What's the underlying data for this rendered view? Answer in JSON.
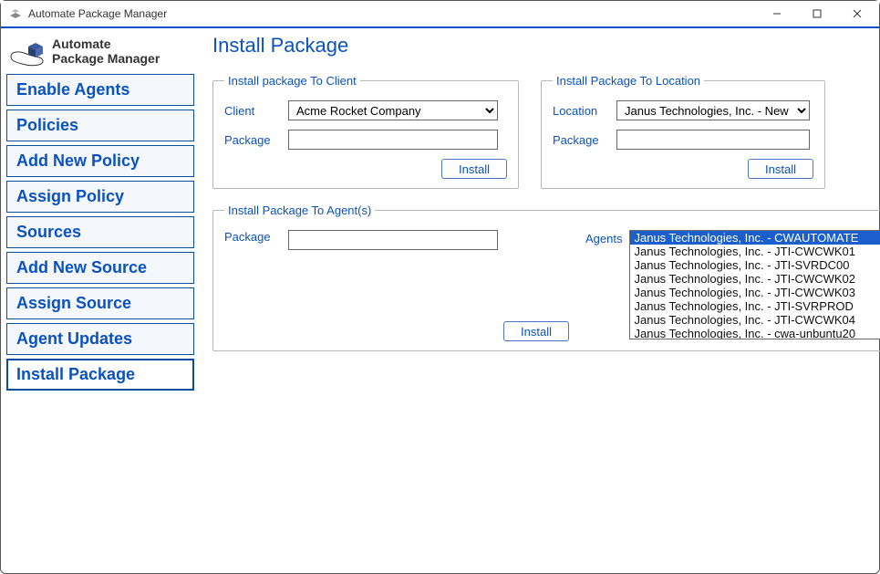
{
  "window": {
    "title": "Automate Package Manager"
  },
  "brand": {
    "line1": "Automate",
    "line2": "Package Manager"
  },
  "nav": {
    "items": [
      "Enable Agents",
      "Policies",
      "Add New Policy",
      "Assign Policy",
      "Sources",
      "Add New Source",
      "Assign Source",
      "Agent Updates",
      "Install Package"
    ],
    "selected_index": 8
  },
  "page": {
    "title": "Install Package"
  },
  "group_client": {
    "legend": "Install package To Client",
    "client_label": "Client",
    "client_value": "Acme Rocket Company",
    "package_label": "Package",
    "package_value": "",
    "install_label": "Install"
  },
  "group_location": {
    "legend": "Install Package To Location",
    "location_label": "Location",
    "location_value": "Janus Technologies, Inc. - New Com",
    "package_label": "Package",
    "package_value": "",
    "install_label": "Install"
  },
  "group_agents": {
    "legend": "Install Package To Agent(s)",
    "package_label": "Package",
    "package_value": "",
    "agents_label": "Agents",
    "install_label": "Install",
    "agents": [
      "Janus Technologies, Inc. - CWAUTOMATE",
      "Janus Technologies, Inc. - JTI-CWCWK01",
      "Janus Technologies, Inc. - JTI-SVRDC00",
      "Janus Technologies, Inc. - JTI-CWCWK02",
      "Janus Technologies, Inc. - JTI-CWCWK03",
      "Janus Technologies, Inc. - JTI-SVRPROD",
      "Janus Technologies, Inc. - JTI-CWCWK04",
      "Janus Technologies, Inc. - cwa-unbuntu20"
    ],
    "selected_agent_index": 0
  }
}
